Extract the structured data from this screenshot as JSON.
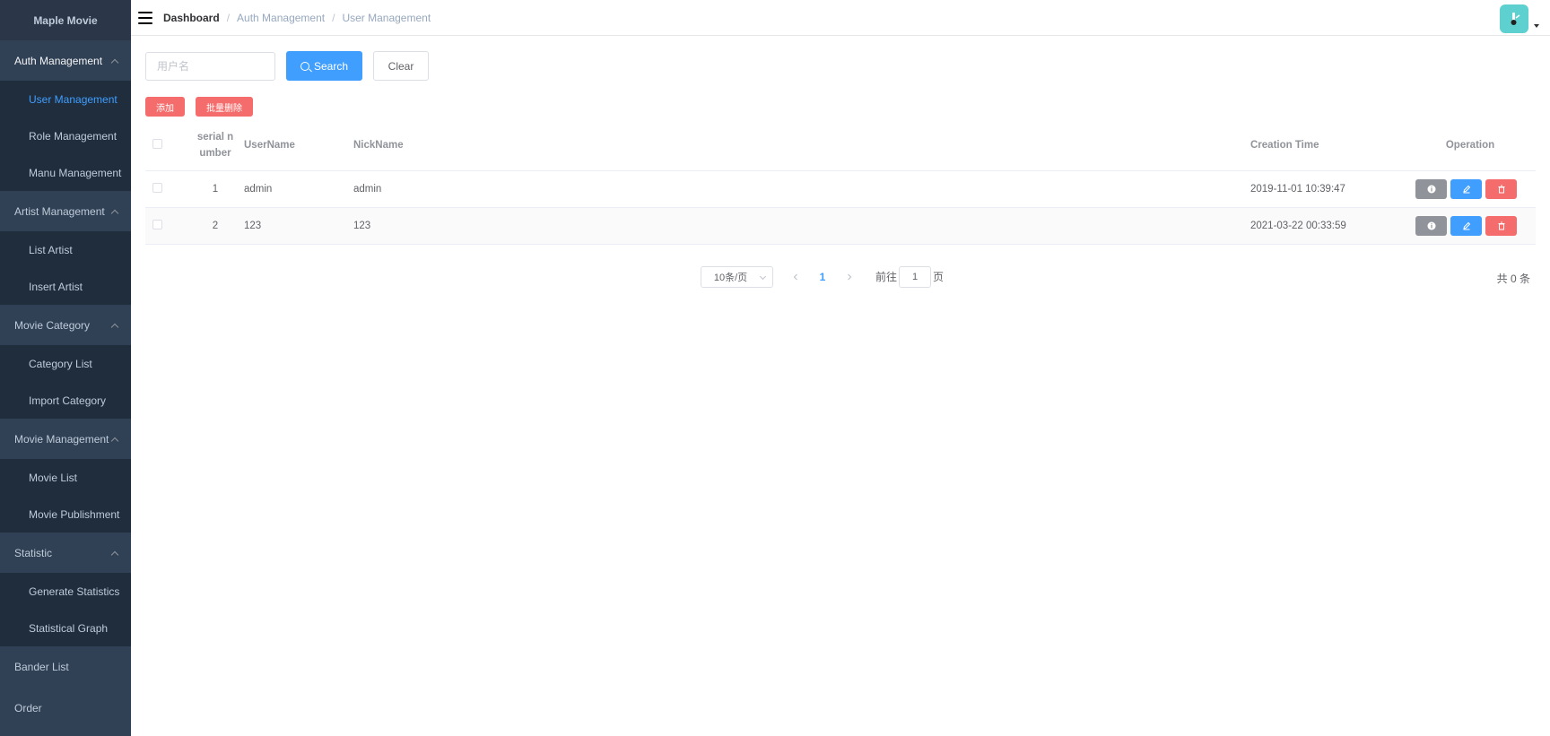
{
  "sidebar": {
    "brand": "Maple Movie",
    "groups": [
      {
        "title": "Auth Management",
        "items": [
          "User Management",
          "Role Management",
          "Manu Management"
        ]
      },
      {
        "title": "Artist Management",
        "items": [
          "List Artist",
          "Insert Artist"
        ]
      },
      {
        "title": "Movie Category",
        "items": [
          "Category List",
          "Import Category"
        ]
      },
      {
        "title": "Movie Management",
        "items": [
          "Movie List",
          "Movie Publishment"
        ]
      },
      {
        "title": "Statistic",
        "items": [
          "Generate Statistics",
          "Statistical Graph"
        ]
      }
    ],
    "solo_items": [
      "Bander List",
      "Order"
    ]
  },
  "navbar": {
    "breadcrumb": [
      "Dashboard",
      "Auth Management",
      "User Management"
    ],
    "separator": "/"
  },
  "search": {
    "placeholder": "用户名",
    "search_label": "Search",
    "clear_label": "Clear"
  },
  "actions": {
    "add_label": "添加",
    "batch_delete_label": "批量删除"
  },
  "table": {
    "headers": {
      "index": "serial n umber",
      "username": "UserName",
      "nickname": "NickName",
      "created": "Creation Time",
      "operation": "Operation"
    },
    "rows": [
      {
        "index": "1",
        "username": "admin",
        "nickname": "admin",
        "created": "2019-11-01 10:39:47"
      },
      {
        "index": "2",
        "username": "123",
        "nickname": "123",
        "created": "2021-03-22 00:33:59"
      }
    ]
  },
  "pagination": {
    "page_size": "10条/页",
    "current_page": "1",
    "goto_prefix": "前往",
    "goto_value": "1",
    "goto_suffix": "页",
    "total": "共 0 条"
  },
  "colors": {
    "sidebar_bg": "#304156",
    "submenu_bg": "#1f2d3d",
    "primary": "#409eff",
    "danger": "#f56c6c",
    "info": "#909399",
    "avatar": "#5fd0d0"
  }
}
